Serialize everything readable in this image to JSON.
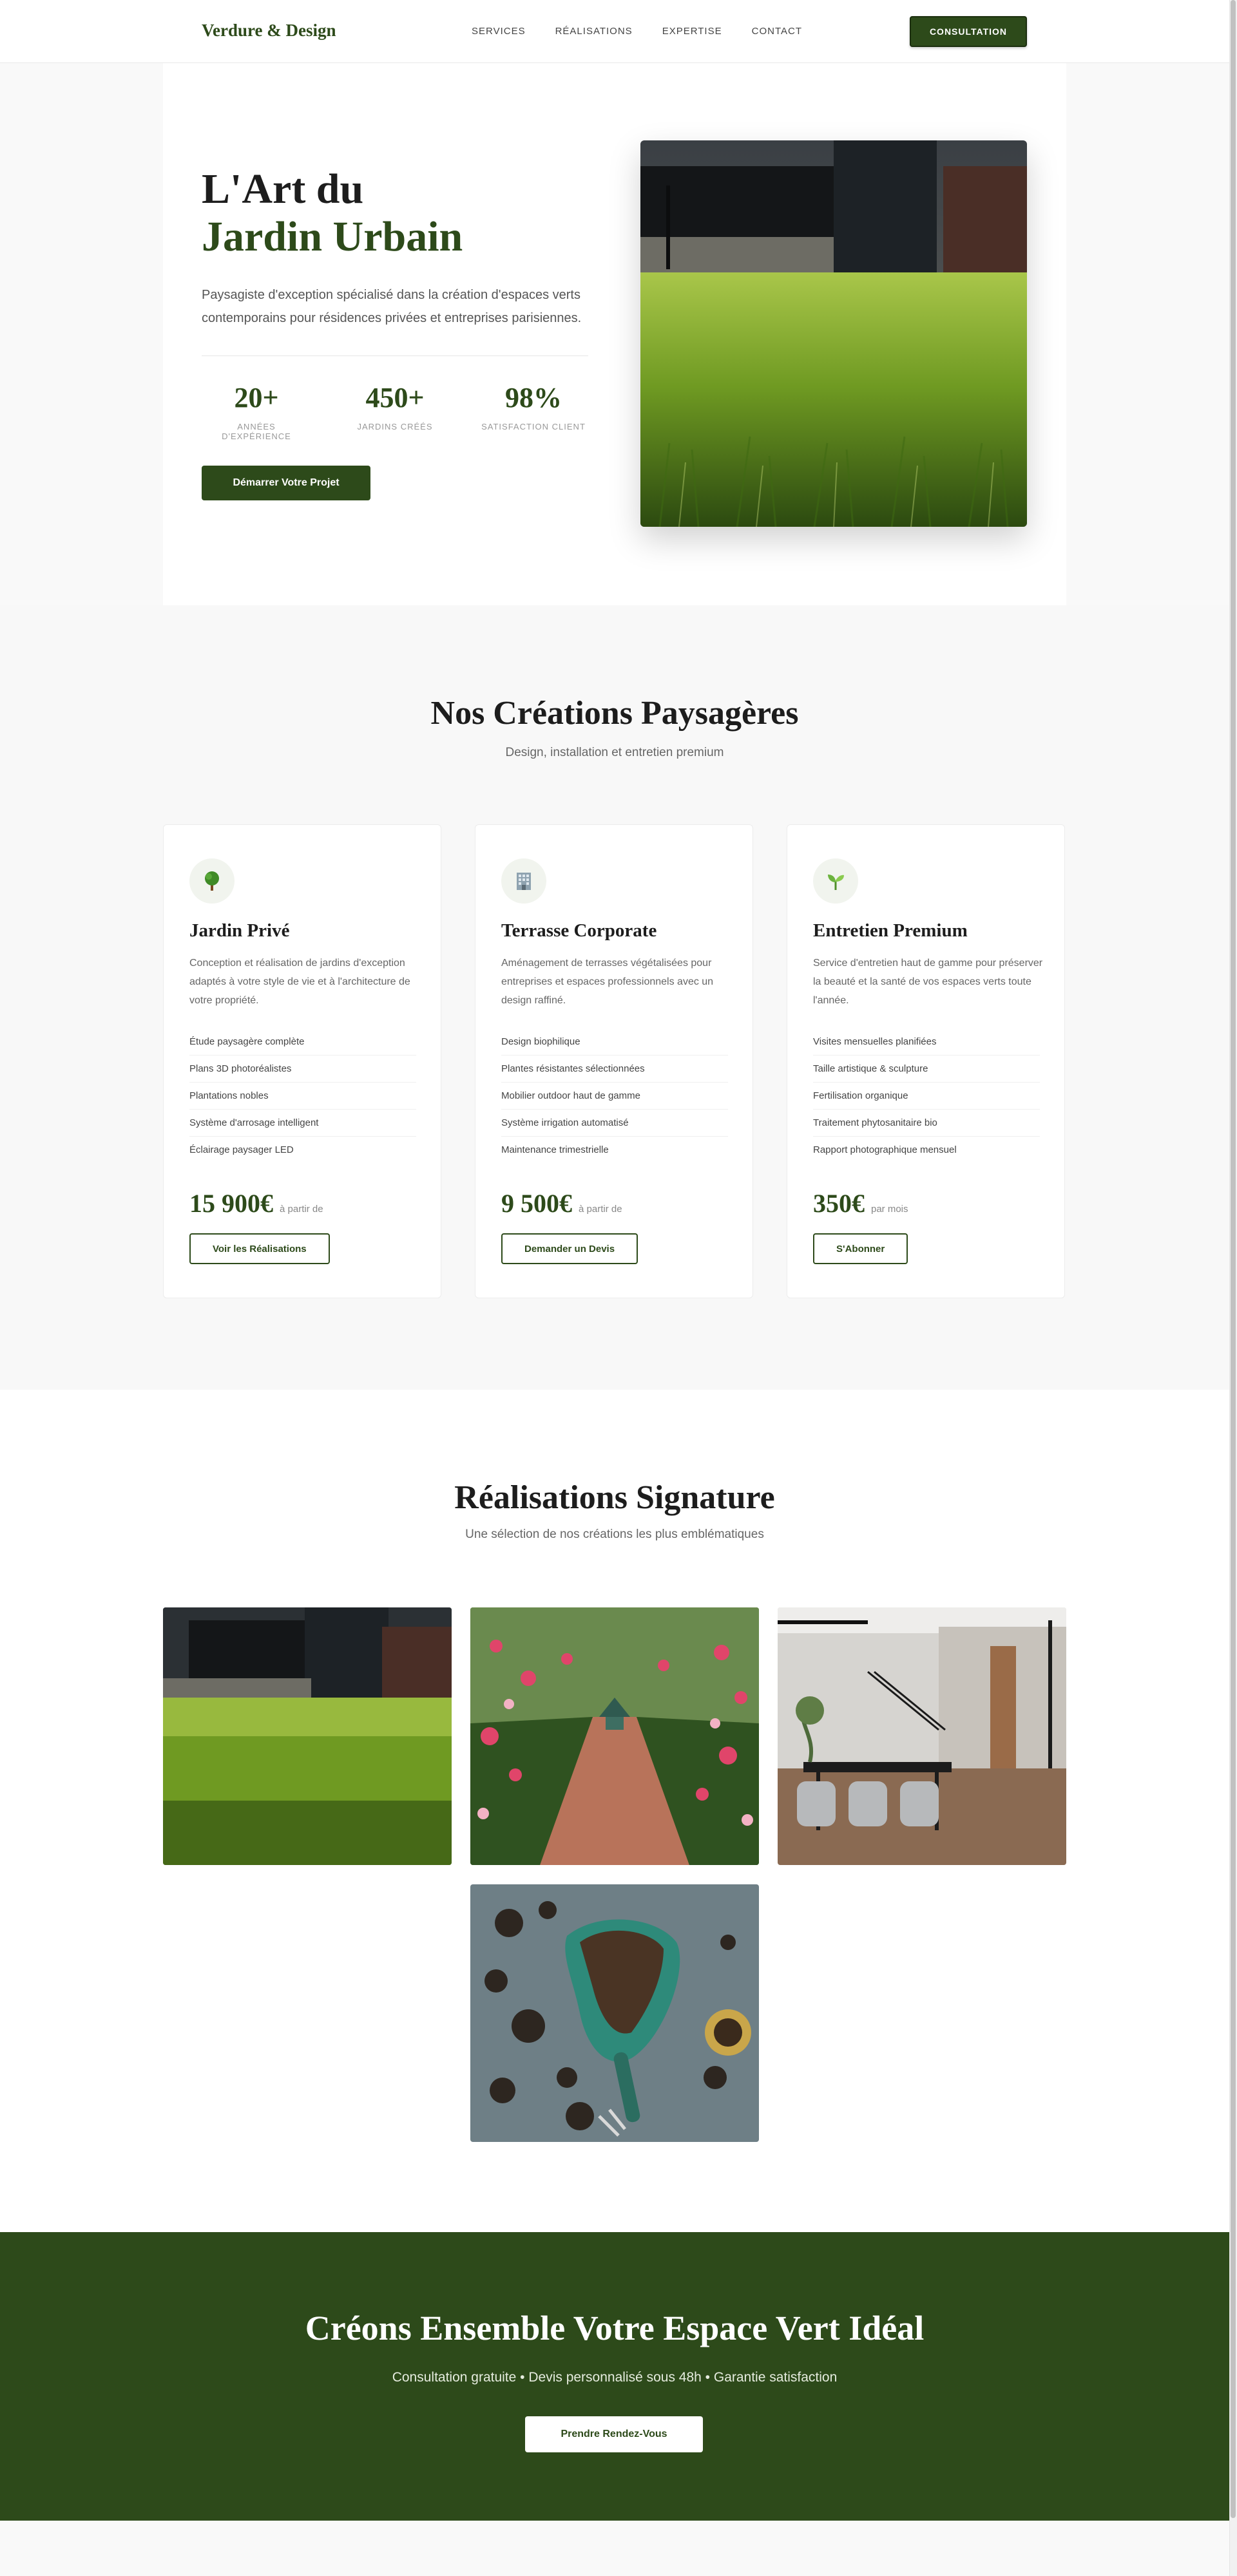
{
  "header": {
    "logo": "Verdure & Design",
    "nav": [
      "SERVICES",
      "RÉALISATIONS",
      "EXPERTISE",
      "CONTACT"
    ],
    "cta": "CONSULTATION"
  },
  "hero": {
    "title_line1": "L'Art du",
    "title_line2": "Jardin Urbain",
    "description": "Paysagiste d'exception spécialisé dans la création d'espaces verts contemporains pour résidences privées et entreprises parisiennes.",
    "stats": [
      {
        "value": "20+",
        "label": "ANNÉES D'EXPÉRIENCE"
      },
      {
        "value": "450+",
        "label": "JARDINS CRÉÉS"
      },
      {
        "value": "98%",
        "label": "SATISFACTION CLIENT"
      }
    ],
    "button": "Démarrer Votre Projet"
  },
  "services": {
    "title": "Nos Créations Paysagères",
    "subtitle": "Design, installation et entretien premium",
    "cards": [
      {
        "icon": "tree-icon",
        "title": "Jardin Privé",
        "description": "Conception et réalisation de jardins d'exception adaptés à votre style de vie et à l'architecture de votre propriété.",
        "features": [
          "Étude paysagère complète",
          "Plans 3D photoréalistes",
          "Plantations nobles",
          "Système d'arrosage intelligent",
          "Éclairage paysager LED"
        ],
        "price": "15 900€",
        "price_suffix": "à partir de",
        "button": "Voir les Réalisations"
      },
      {
        "icon": "office-building-icon",
        "title": "Terrasse Corporate",
        "description": "Aménagement de terrasses végétalisées pour entreprises et espaces professionnels avec un design raffiné.",
        "features": [
          "Design biophilique",
          "Plantes résistantes sélectionnées",
          "Mobilier outdoor haut de gamme",
          "Système irrigation automatisé",
          "Maintenance trimestrielle"
        ],
        "price": "9 500€",
        "price_suffix": "à partir de",
        "button": "Demander un Devis"
      },
      {
        "icon": "seedling-icon",
        "title": "Entretien Premium",
        "description": "Service d'entretien haut de gamme pour préserver la beauté et la santé de vos espaces verts toute l'année.",
        "features": [
          "Visites mensuelles planifiées",
          "Taille artistique & sculpture",
          "Fertilisation organique",
          "Traitement phytosanitaire bio",
          "Rapport photographique mensuel"
        ],
        "price": "350€",
        "price_suffix": "par mois",
        "button": "S'Abonner"
      }
    ]
  },
  "gallery": {
    "title": "Réalisations Signature",
    "subtitle": "Une sélection de nos créations les plus emblématiques"
  },
  "cta": {
    "title": "Créons Ensemble Votre Espace Vert Idéal",
    "subtitle": "Consultation gratuite • Devis personnalisé sous 48h • Garantie satisfaction",
    "button": "Prendre Rendez-Vous"
  },
  "colors": {
    "brand": "#2d4a1a",
    "background": "#f8f8f8"
  }
}
